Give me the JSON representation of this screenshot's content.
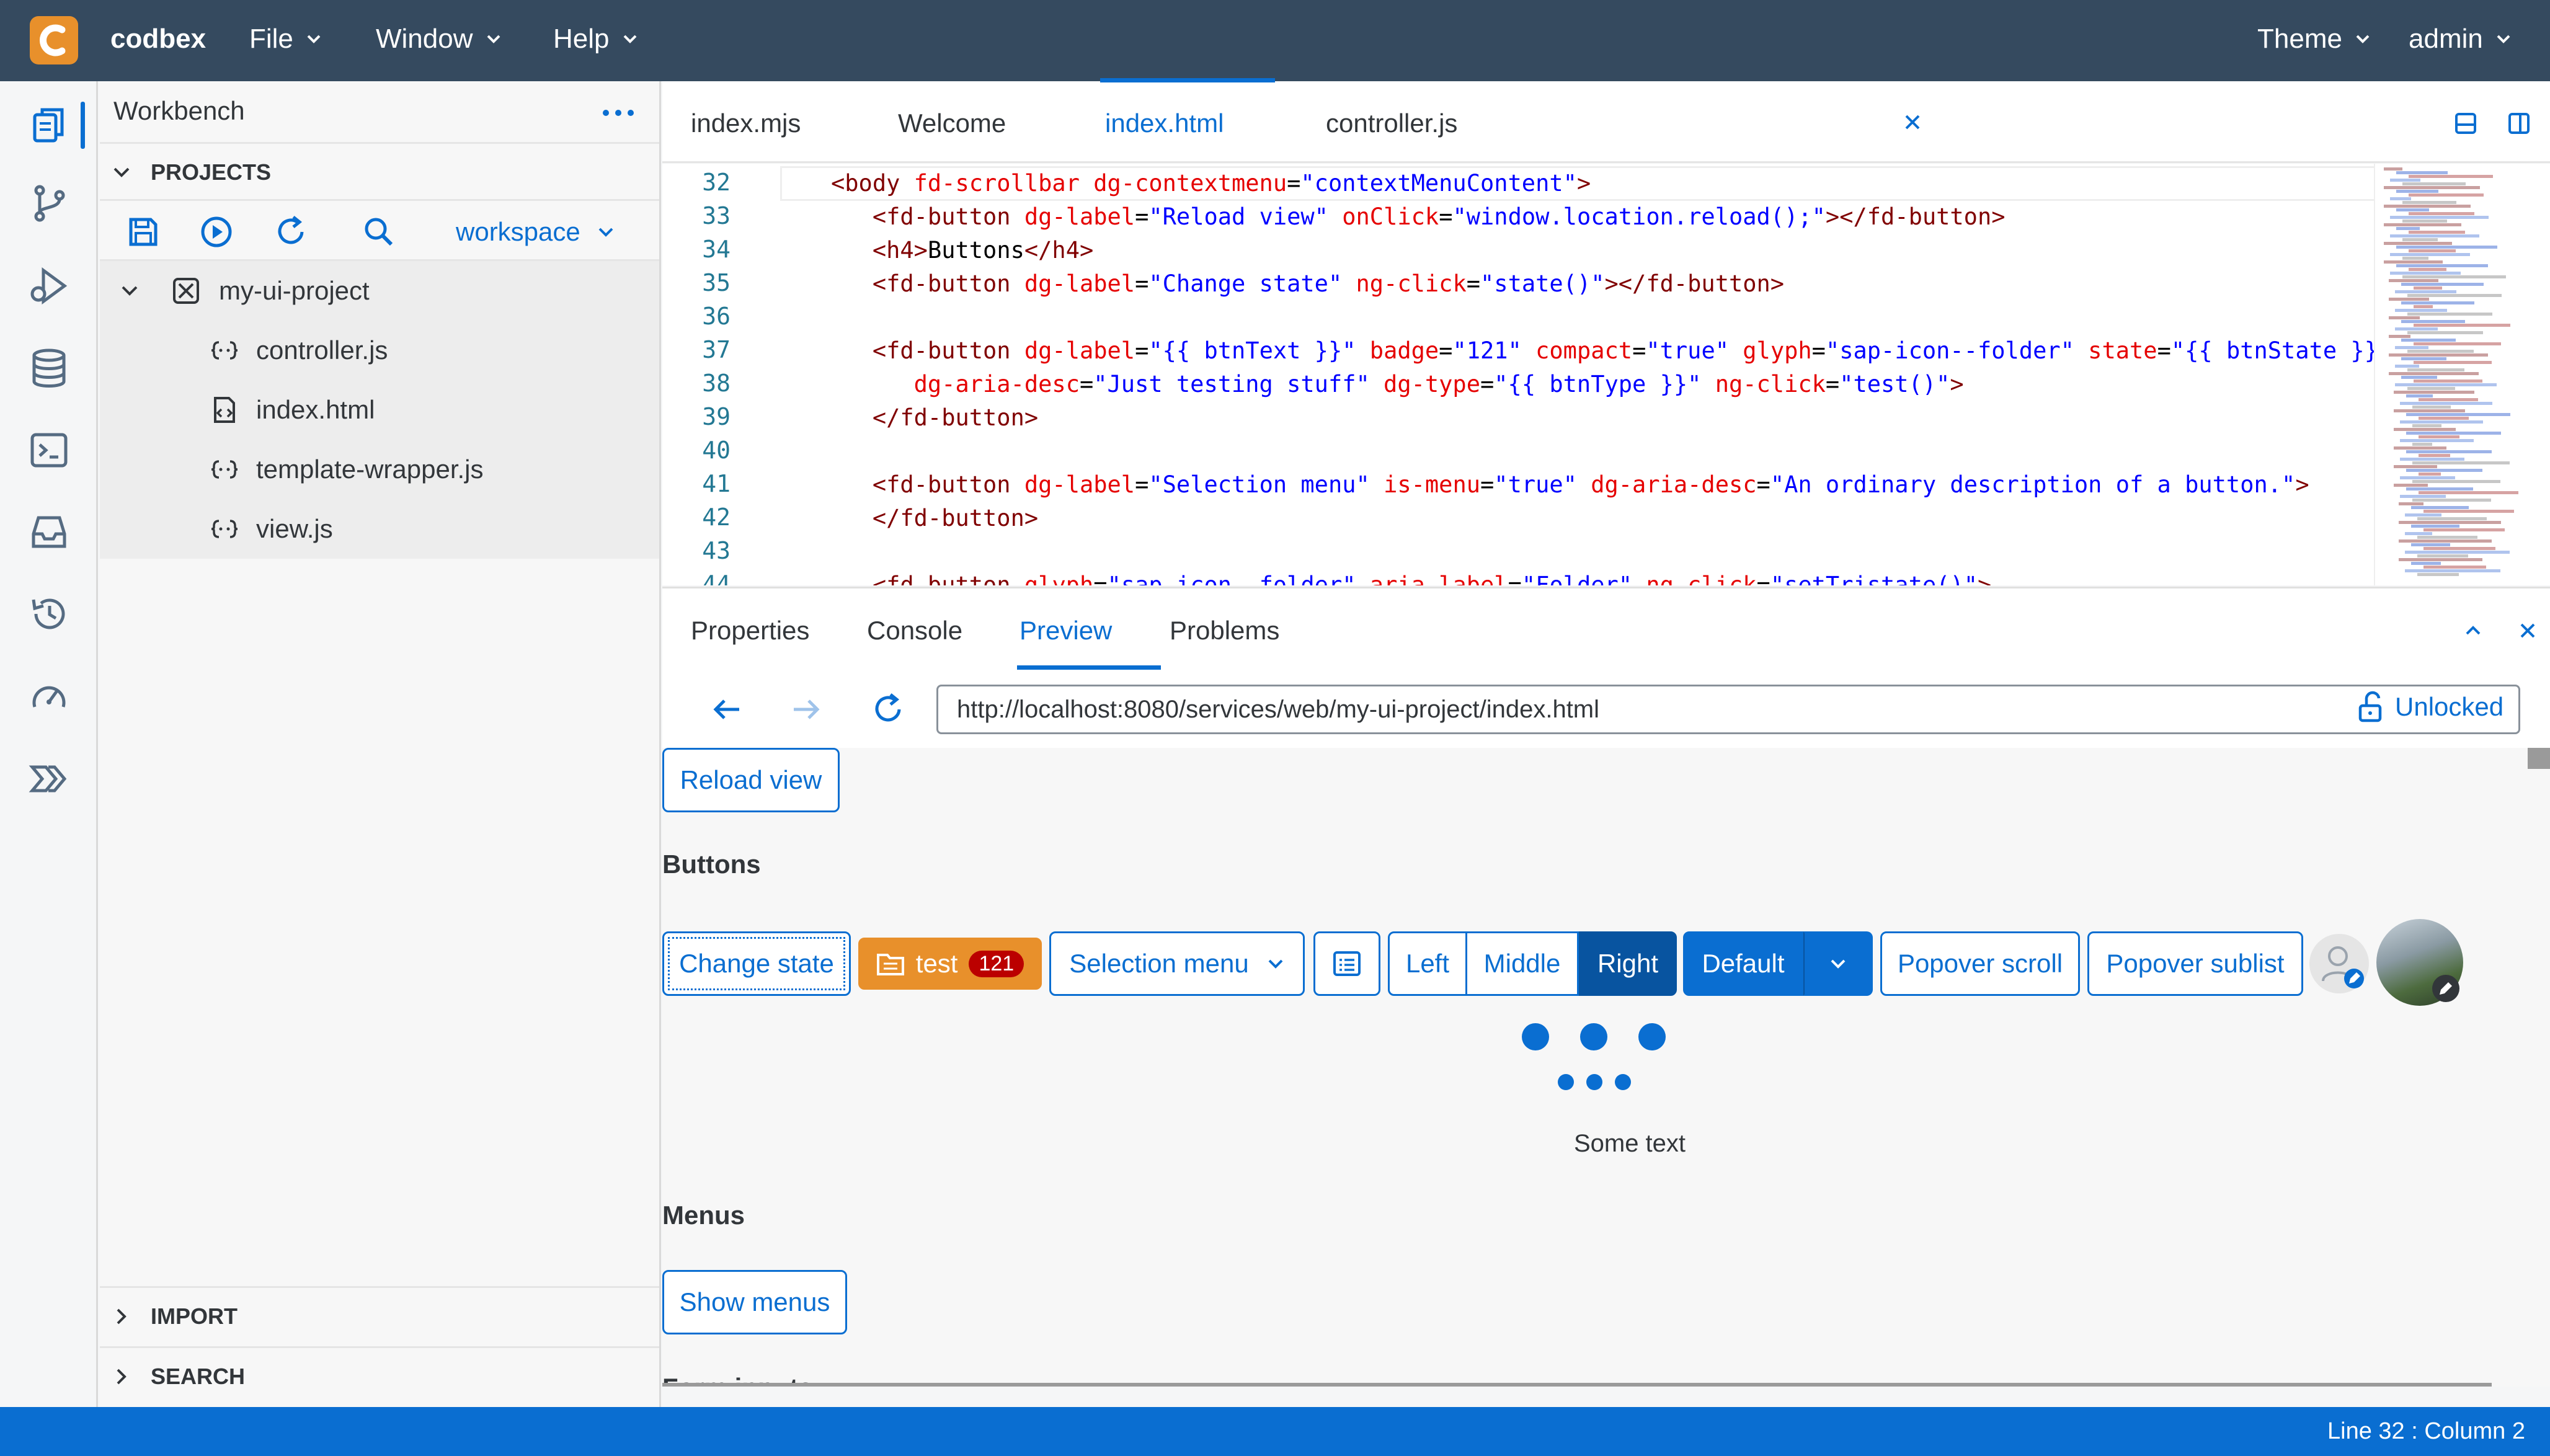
{
  "app": {
    "name": "codbex"
  },
  "menubar": {
    "items": [
      {
        "label": "File"
      },
      {
        "label": "Window"
      },
      {
        "label": "Help"
      }
    ],
    "theme_label": "Theme",
    "user_label": "admin"
  },
  "sidebar": {
    "title": "Workbench",
    "sections": {
      "projects": "PROJECTS",
      "import": "IMPORT",
      "search": "SEARCH"
    },
    "workspace": "workspace",
    "project": "my-ui-project",
    "files": [
      "controller.js",
      "index.html",
      "template-wrapper.js",
      "view.js"
    ]
  },
  "editor": {
    "tabs": [
      "index.mjs",
      "Welcome",
      "index.html",
      "controller.js"
    ],
    "active_tab": "index.html",
    "line_numbers": [
      "32",
      "33",
      "34",
      "35",
      "36",
      "37",
      "38",
      "39",
      "40",
      "41",
      "42",
      "43",
      "44"
    ]
  },
  "panel": {
    "tabs": [
      "Properties",
      "Console",
      "Preview",
      "Problems"
    ],
    "active_tab": "Preview",
    "url": "http://localhost:8080/services/web/my-ui-project/index.html",
    "lock_label": "Unlocked"
  },
  "preview": {
    "reload_button": "Reload view",
    "buttons_heading": "Buttons",
    "change_state": "Change state",
    "test_button": "test",
    "test_badge": "121",
    "selection_menu": "Selection menu",
    "segmented": [
      "Left",
      "Middle",
      "Right"
    ],
    "default_button": "Default",
    "popover_scroll": "Popover scroll",
    "popover_sublist": "Popover sublist",
    "some_text": "Some text",
    "menus_heading": "Menus",
    "show_menus": "Show menus",
    "form_inputs_heading": "Form inputs"
  },
  "status": {
    "cursor": "Line 32 : Column 2"
  },
  "colors": {
    "header": "#354a5f",
    "accent": "#0a6ed1",
    "brand": "#e8902b",
    "status": "#0a6ed1"
  }
}
